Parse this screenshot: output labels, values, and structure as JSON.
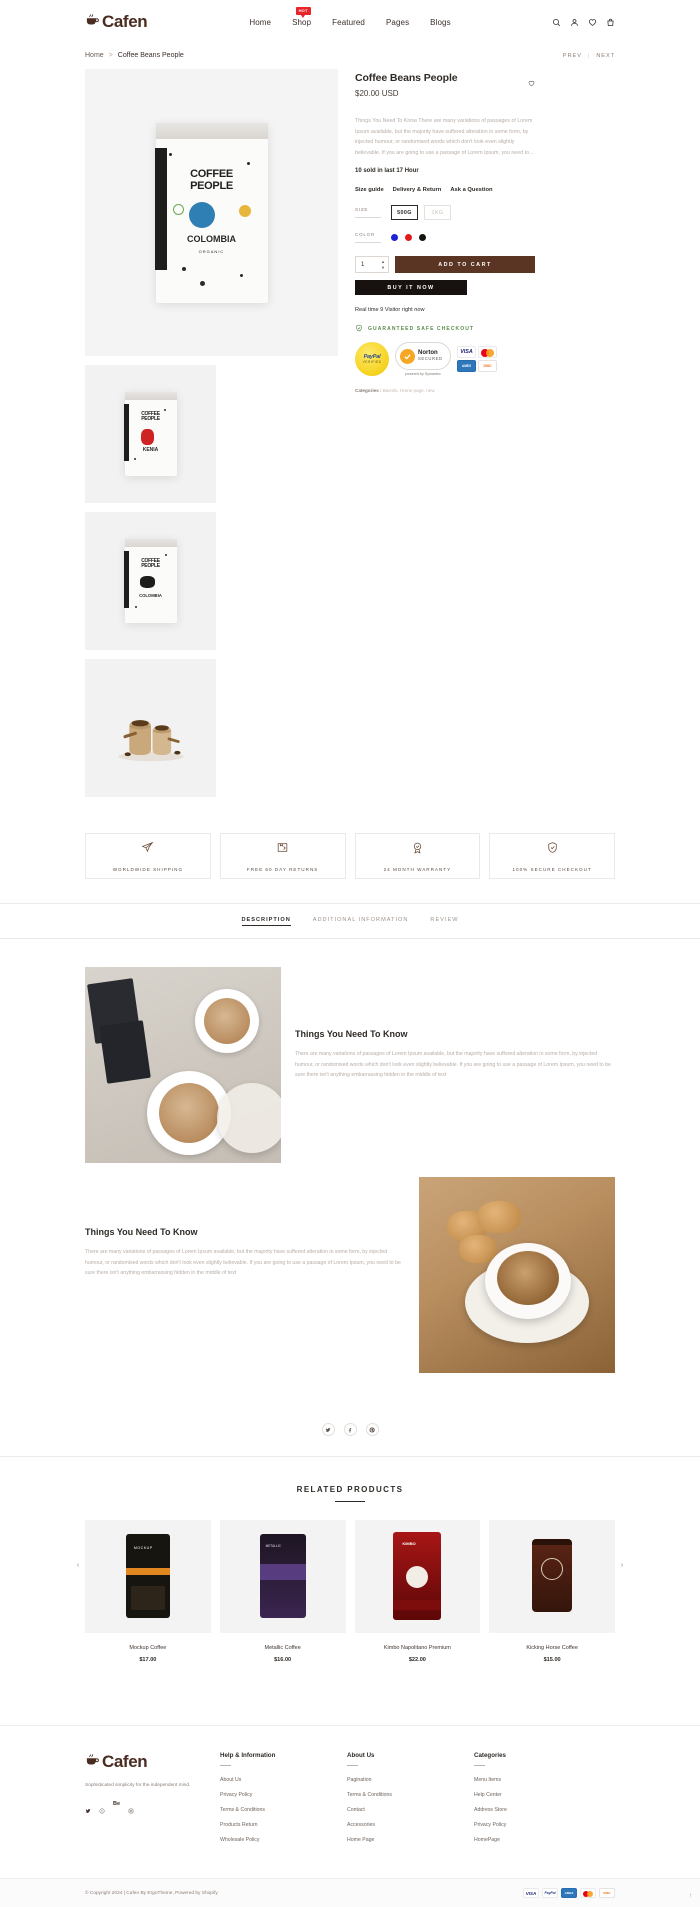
{
  "header": {
    "brand": "Cafen",
    "nav": [
      {
        "label": "Home",
        "badge": null
      },
      {
        "label": "Shop",
        "badge": "HOT"
      },
      {
        "label": "Featured",
        "badge": null
      },
      {
        "label": "Pages",
        "badge": null
      },
      {
        "label": "Blogs",
        "badge": null
      }
    ],
    "icons": [
      "search-icon",
      "account-icon",
      "wishlist-icon",
      "cart-icon"
    ]
  },
  "breadcrumb": {
    "home": "Home",
    "separator": ">",
    "current": "Coffee Beans People",
    "prev": "PREV",
    "next": "NEXT",
    "divider": "|"
  },
  "product": {
    "title": "Coffee Beans People",
    "price": "$20.00 USD",
    "description": "Things You Need To Know There are many variations of passages of Lorem Ipsum available, but the majority have suffered alteration in some form, by injected humour, or randomised words which don't look even slightly believable. If you are going to use a passage of Lorem Ipsum, you need to...",
    "sold": "10 sold in last 17 Hour",
    "links": [
      "Size guide",
      "Delivery & Return",
      "Ask a Question"
    ],
    "size_label": "SIZE",
    "sizes": [
      {
        "label": "500G",
        "selected": true
      },
      {
        "label": "1KG",
        "selected": false
      }
    ],
    "color_label": "COLOR",
    "colors": [
      {
        "name": "blue",
        "hex": "#1a23d6"
      },
      {
        "name": "red",
        "hex": "#e01a1a"
      },
      {
        "name": "black",
        "hex": "#16140f"
      }
    ],
    "quantity": "1",
    "add_to_cart": "ADD TO CART",
    "buy_it_now": "BUY IT NOW",
    "realtime": "Real time 9 Visitor right now",
    "safe_checkout": "GUARANTEED SAFE CHECKOUT",
    "badges": {
      "paypal_1": "PayPal",
      "paypal_2": "VERIFIED",
      "norton_1": "Norton",
      "norton_2": "SECURED",
      "symantec": "powered by Symantec",
      "cards": [
        "VISA",
        "mastercard",
        "AMERICAN EXPRESS",
        "DISCOVER"
      ]
    },
    "categories_label": "Categories :",
    "categories_value": "Barrels, Home page, new",
    "wishlist_icon": "heart-icon"
  },
  "features": [
    {
      "icon": "plane-icon",
      "label": "WORLDWIDE SHIPPING"
    },
    {
      "icon": "return-box-icon",
      "label": "FREE 60 DAY RETURNS"
    },
    {
      "icon": "warranty-icon",
      "label": "24 MONTH WARRANTY"
    },
    {
      "icon": "shield-check-icon",
      "label": "100% SECURE CHECKOUT"
    }
  ],
  "tabs": [
    {
      "label": "DESCRIPTION",
      "active": true
    },
    {
      "label": "ADDITIONAL INFORMATION",
      "active": false
    },
    {
      "label": "REVIEW",
      "active": false
    }
  ],
  "description_blocks": [
    {
      "heading": "Things You Need To Know",
      "text": "There are many variations of passages of Lorem Ipsum available, but the majority have suffered alteration in some form, by injected humour, or randomised words which don't look even slightly believable. If you are going to use a passage of Lorem Ipsum, you need to be sure there isn't anything embarrassing hidden in the middle of text"
    },
    {
      "heading": "Things You Need To Know",
      "text": "There are many variations of passages of Lorem Ipsum available, but the majority have suffered alteration in some form, by injected humour, or randomised words which don't look even slightly believable. If you are going to use a passage of Lorem Ipsum, you need to be sure there isn't anything embarrassing hidden in the middle of text"
    }
  ],
  "share": [
    "twitter-icon",
    "facebook-icon",
    "pinterest-icon"
  ],
  "related": {
    "title": "RELATED PRODUCTS",
    "prev_arrow": "‹",
    "next_arrow": "›",
    "items": [
      {
        "name": "Mockup Coffee",
        "price": "$17.00",
        "color": "#17150f"
      },
      {
        "name": "Metallic Coffee",
        "price": "$16.00",
        "color": "#2a1c3a"
      },
      {
        "name": "Kimbo Napolitano Premium",
        "price": "$22.00",
        "color": "#8c1414"
      },
      {
        "name": "Kicking Horse Coffee",
        "price": "$15.00",
        "color": "#4a1d12"
      }
    ]
  },
  "footer": {
    "brand": "Cafen",
    "tagline": "Sophisticated simplicity for the independent mind.",
    "social": [
      "twitter-icon",
      "pinterest-icon",
      "behance-icon",
      "instagram-icon"
    ],
    "columns": [
      {
        "heading": "Help & Information",
        "links": [
          "About Us",
          "Privacy Policy",
          "Terms & Conditions",
          "Products Return",
          "Wholesale Policy"
        ]
      },
      {
        "heading": "About Us",
        "links": [
          "Pagination",
          "Terms & Conditions",
          "Contact",
          "Accessories",
          "Home Page"
        ]
      },
      {
        "heading": "Categories",
        "links": [
          "Menu Items",
          "Help Center",
          "Address Store",
          "Privacy Policy",
          "HomePage"
        ]
      }
    ],
    "copyright": "© Copyright 2024 | Cafen By ErgoTheme, Powered by Shopify",
    "cards": [
      "VISA",
      "PayPal",
      "AMEX",
      "mastercard",
      "DISCOVER"
    ],
    "scroll_top": "↑"
  }
}
